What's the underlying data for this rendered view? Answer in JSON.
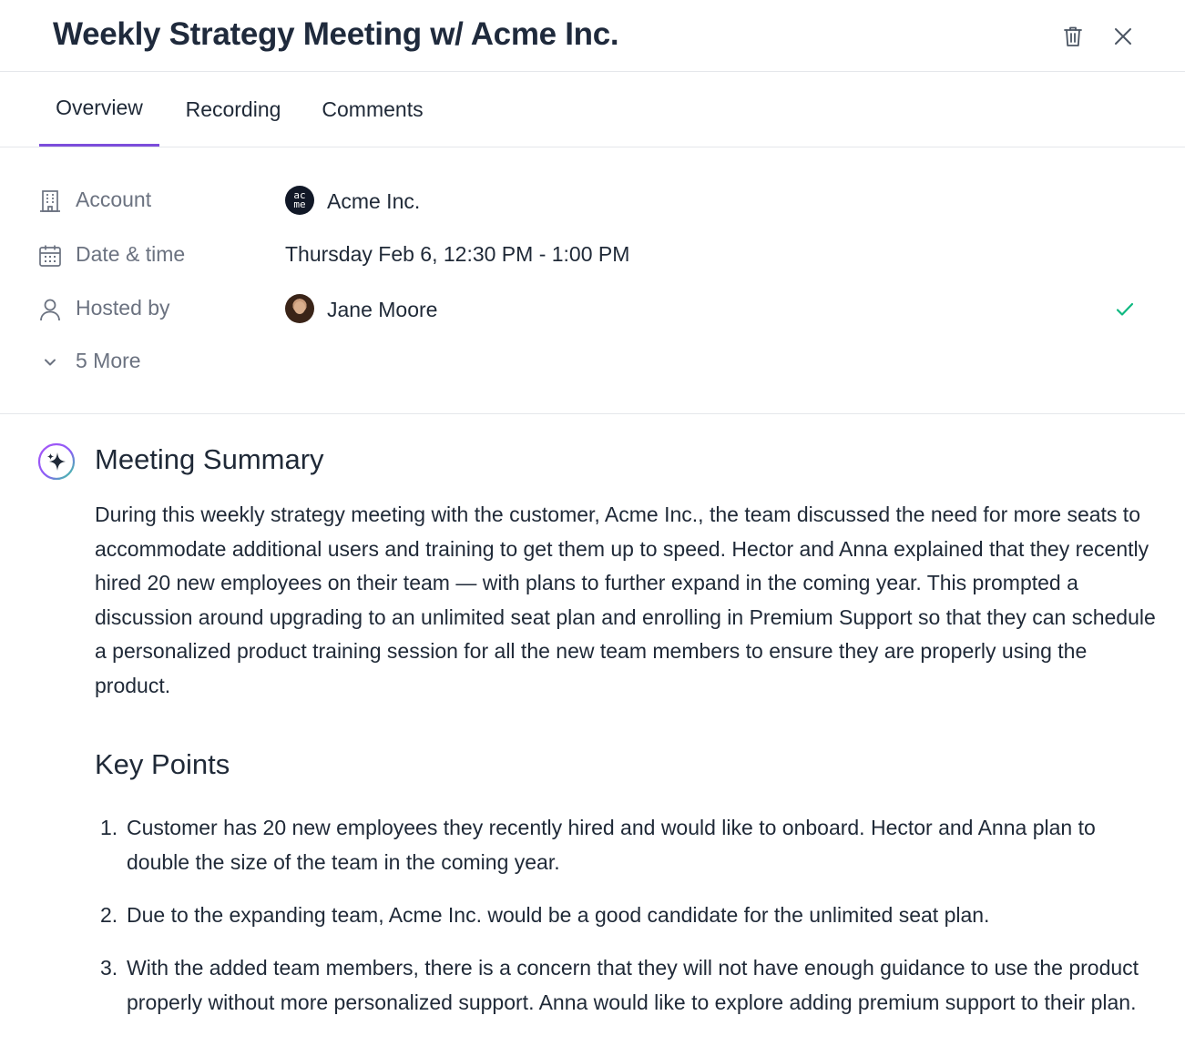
{
  "header": {
    "title": "Weekly Strategy Meeting w/ Acme Inc."
  },
  "tabs": [
    {
      "label": "Overview",
      "active": true
    },
    {
      "label": "Recording",
      "active": false
    },
    {
      "label": "Comments",
      "active": false
    }
  ],
  "details": {
    "account": {
      "label": "Account",
      "value": "Acme Inc.",
      "logo_text": [
        "ac",
        "me"
      ]
    },
    "datetime": {
      "label": "Date & time",
      "value": "Thursday Feb 6, 12:30 PM - 1:00 PM"
    },
    "host": {
      "label": "Hosted by",
      "value": "Jane Moore"
    },
    "more": {
      "label": "5 More"
    }
  },
  "summary": {
    "title": "Meeting Summary",
    "text": "During this weekly strategy meeting with the customer, Acme Inc., the team discussed the need for more seats to accommodate additional users and training to get them up to speed. Hector and Anna explained that they recently hired 20 new employees on their team — with plans to further expand in the coming year. This prompted a discussion around upgrading to an unlimited seat plan and enrolling in Premium Support so that they can schedule a personalized product training session for all the new team members to ensure they are properly using the product."
  },
  "key_points": {
    "title": "Key Points",
    "items": [
      {
        "num": "1.",
        "text": "Customer has 20 new employees they recently hired and would like to onboard. Hector and Anna plan to double the size of the team in the coming year."
      },
      {
        "num": "2.",
        "text": "Due to the expanding team, Acme Inc. would be a good candidate for the unlimited seat plan."
      },
      {
        "num": "3.",
        "text": "With the added team members, there is a concern that they will not have enough guidance to use the product properly without more personalized support. Anna would like to explore adding premium support to their plan."
      }
    ]
  },
  "colors": {
    "accent": "#7c4ddb",
    "check": "#10b981",
    "muted_text": "#6b7280",
    "title_text": "#1f2a3c"
  },
  "icons": {
    "trash": "trash-icon",
    "close": "close-icon",
    "account": "building-icon",
    "datetime": "calendar-icon",
    "host": "user-icon",
    "more": "chevron-down-icon",
    "check": "check-icon",
    "summary": "sparkle-icon"
  }
}
